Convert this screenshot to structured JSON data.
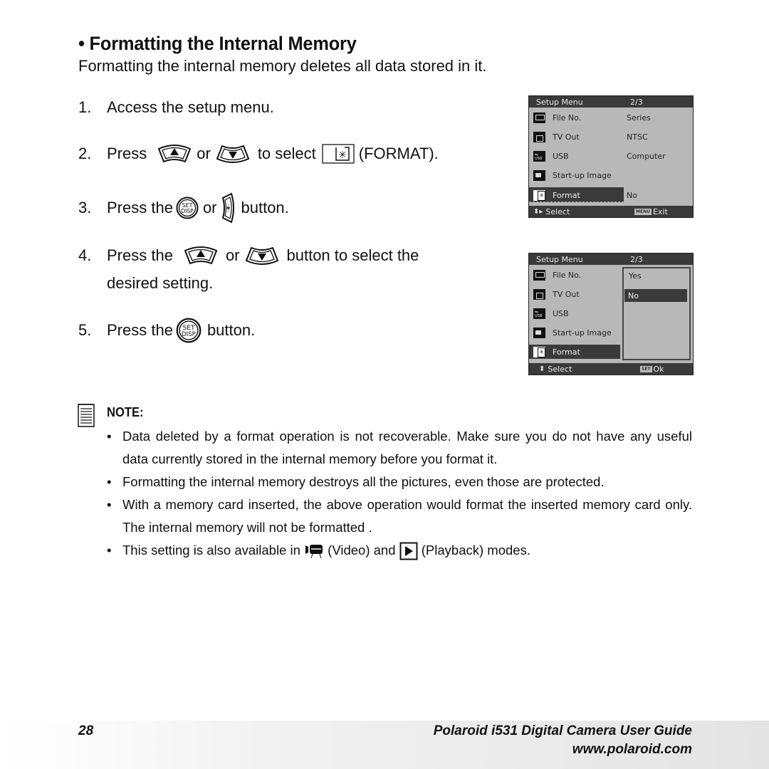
{
  "section": {
    "title": "• Formatting the Internal Memory",
    "intro": "Formatting the internal memory deletes all data stored in it."
  },
  "steps": [
    {
      "num": "1.",
      "text": "Access the setup menu."
    },
    {
      "num": "2.",
      "pre": "Press",
      "or": "or",
      "mid": "to select",
      "post": "(FORMAT)."
    },
    {
      "num": "3.",
      "pre": "Press the",
      "or": "or",
      "post": "button."
    },
    {
      "num": "4.",
      "pre": "Press the",
      "or": "or",
      "post": "button to select the",
      "line2": "desired setting."
    },
    {
      "num": "5.",
      "pre": "Press the",
      "post": "button."
    }
  ],
  "screen1": {
    "header": "Setup Menu",
    "page": "2/3",
    "items": [
      {
        "label": "File No.",
        "value": "Series",
        "icon": "file-number-icon"
      },
      {
        "label": "TV Out",
        "value": "NTSC",
        "icon": "tv-icon"
      },
      {
        "label": "USB",
        "value": "Computer",
        "icon": "usb-icon"
      },
      {
        "label": "Start-up Image",
        "value": "",
        "icon": "startup-image-icon"
      },
      {
        "label": "Format",
        "value": "No",
        "icon": "format-icon",
        "selected": true
      }
    ],
    "footer_left": "Select",
    "footer_badge": "MENU",
    "footer_right": "Exit"
  },
  "screen2": {
    "header": "Setup Menu",
    "page": "2/3",
    "items": [
      {
        "label": "File No.",
        "icon": "file-number-icon"
      },
      {
        "label": "TV Out",
        "icon": "tv-icon"
      },
      {
        "label": "USB",
        "icon": "usb-icon"
      },
      {
        "label": "Start-up Image",
        "icon": "startup-image-icon"
      },
      {
        "label": "Format",
        "icon": "format-icon",
        "selected": true
      }
    ],
    "options": [
      {
        "label": "Yes",
        "selected": false
      },
      {
        "label": "No",
        "selected": true
      }
    ],
    "footer_left": "Select",
    "footer_badge": "SET",
    "footer_right": "Ok"
  },
  "note": {
    "label": "NOTE:",
    "bullets": [
      "Data deleted by a format operation is not recoverable. Make sure you do not have any useful data currently stored in the internal memory before you format it.",
      "Formatting the internal memory destroys all the pictures, even those are protected.",
      "With a memory card inserted, the above operation would format the inserted memory card only. The internal memory will not be formatted .",
      {
        "pre": "This setting is also available in",
        "video": "(Video) and",
        "playback": "(Playback) modes."
      }
    ]
  },
  "footer": {
    "page_number": "28",
    "guide_title": "Polaroid i531 Digital Camera User Guide",
    "url": "www.polaroid.com"
  },
  "icons": {
    "up": "up-button-icon",
    "down": "down-button-icon",
    "format": "format-icon",
    "set_disp": "set-disp-button-icon",
    "flash_right": "flash-right-button-icon",
    "video": "video-mode-icon",
    "playback": "playback-mode-icon",
    "note": "note-pad-icon"
  }
}
